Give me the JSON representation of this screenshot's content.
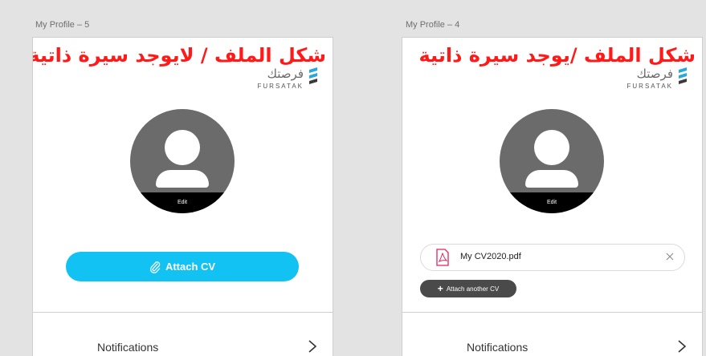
{
  "frames": [
    {
      "title": "My Profile – 5",
      "overlay_title": "شكل الملف / لايوجد سيرة ذاتية",
      "logo": {
        "arabic": "فرصتك",
        "latin": "FURSATAK"
      },
      "avatar_edit": "Edit",
      "attach_cv_label": "Attach CV",
      "notifications_label": "Notifications"
    },
    {
      "title": "My Profile – 4",
      "overlay_title": "شكل الملف /يوجد سيرة ذاتية",
      "logo": {
        "arabic": "فرصتك",
        "latin": "FURSATAK"
      },
      "avatar_edit": "Edit",
      "cv_file_name": "My CV2020.pdf",
      "attach_another_label": "Attach another CV",
      "notifications_label": "Notifications"
    }
  ],
  "colors": {
    "overlay_red": "#ff1a1a",
    "attach_blue": "#12c2f2",
    "pdf_red": "#e0245e",
    "logo_blue": "#29a8e0"
  },
  "icons": [
    "paperclip-icon",
    "pdf-icon",
    "close-icon",
    "plus-icon",
    "chevron-right-icon",
    "user-silhouette-icon"
  ]
}
